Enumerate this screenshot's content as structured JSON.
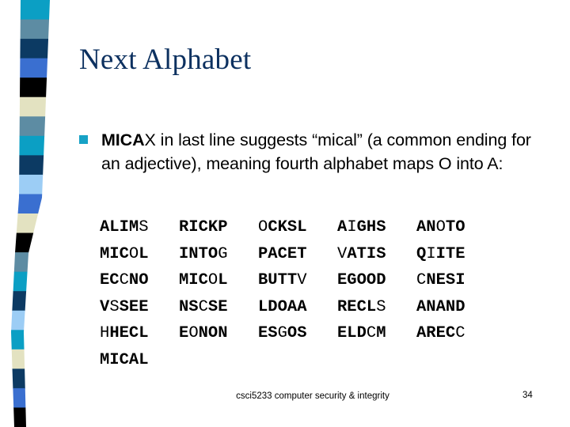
{
  "slide": {
    "title": "Next Alphabet",
    "title_color": "#0d3160",
    "background_color": "#ffffff"
  },
  "bullet": {
    "marker_color": "#17a2c6",
    "bold_lead": "MICA",
    "text": "X in last line suggests “mical” (a common ending for an adjective), meaning fourth alphabet maps O into A:"
  },
  "cipher_grid": {
    "rows": [
      [
        [
          [
            "ALIM",
            true
          ],
          [
            "S",
            false
          ]
        ],
        [
          [
            "RICKP",
            true
          ]
        ],
        [
          [
            "O",
            false
          ],
          [
            "CKSL",
            true
          ]
        ],
        [
          [
            "A",
            true
          ],
          [
            "I",
            false
          ],
          [
            "GHS",
            true
          ]
        ],
        [
          [
            "AN",
            true
          ],
          [
            "O",
            false
          ],
          [
            "TO",
            true
          ]
        ]
      ],
      [
        [
          [
            "MIC",
            true
          ],
          [
            "O",
            false
          ],
          [
            "L",
            true
          ]
        ],
        [
          [
            "INTO",
            true
          ],
          [
            "G",
            false
          ]
        ],
        [
          [
            "PACET",
            true
          ]
        ],
        [
          [
            "V",
            false
          ],
          [
            "ATIS",
            true
          ]
        ],
        [
          [
            "Q",
            true
          ],
          [
            "I",
            false
          ],
          [
            "ITE",
            true
          ]
        ]
      ],
      [
        [
          [
            "EC",
            true
          ],
          [
            "C",
            false
          ],
          [
            "NO",
            true
          ]
        ],
        [
          [
            "MIC",
            true
          ],
          [
            "O",
            false
          ],
          [
            "L",
            true
          ]
        ],
        [
          [
            "BUTT",
            true
          ],
          [
            "V",
            false
          ]
        ],
        [
          [
            "EGOOD",
            true
          ]
        ],
        [
          [
            "C",
            false
          ],
          [
            "NESI",
            true
          ]
        ]
      ],
      [
        [
          [
            "V",
            true
          ],
          [
            "S",
            false
          ],
          [
            "SEE",
            true
          ]
        ],
        [
          [
            "NS",
            true
          ],
          [
            "C",
            false
          ],
          [
            "SE",
            true
          ]
        ],
        [
          [
            "LDOAA",
            true
          ]
        ],
        [
          [
            "RECL",
            true
          ],
          [
            "S",
            false
          ]
        ],
        [
          [
            "ANAND",
            true
          ]
        ]
      ],
      [
        [
          [
            "H",
            false
          ],
          [
            "HECL",
            true
          ]
        ],
        [
          [
            "E",
            true
          ],
          [
            "O",
            false
          ],
          [
            "NON",
            true
          ]
        ],
        [
          [
            "ES",
            true
          ],
          [
            "G",
            false
          ],
          [
            "OS",
            true
          ]
        ],
        [
          [
            "ELD",
            true
          ],
          [
            "C",
            false
          ],
          [
            "M",
            true
          ]
        ],
        [
          [
            "AREC",
            true
          ],
          [
            "C",
            false
          ]
        ]
      ],
      [
        [
          [
            "MICAL",
            true
          ]
        ]
      ]
    ]
  },
  "footer": {
    "text": "csci5233 computer security & integrity",
    "page_number": "34"
  },
  "decor_stripe": {
    "colors": [
      "#0b9fc4",
      "#5d8ca3",
      "#0c3a63",
      "#3a6fd0",
      "#000000",
      "#e3e2c1",
      "#5d8ca3",
      "#0b9fc4",
      "#0c3a63",
      "#9ccdf5",
      "#3a6fd0",
      "#e3e2c1",
      "#000000",
      "#5d8ca3",
      "#0b9fc4",
      "#0c3a63",
      "#9ccdf5",
      "#0b9fc4",
      "#e3e2c1",
      "#0c3a63",
      "#3a6fd0",
      "#000000"
    ]
  }
}
